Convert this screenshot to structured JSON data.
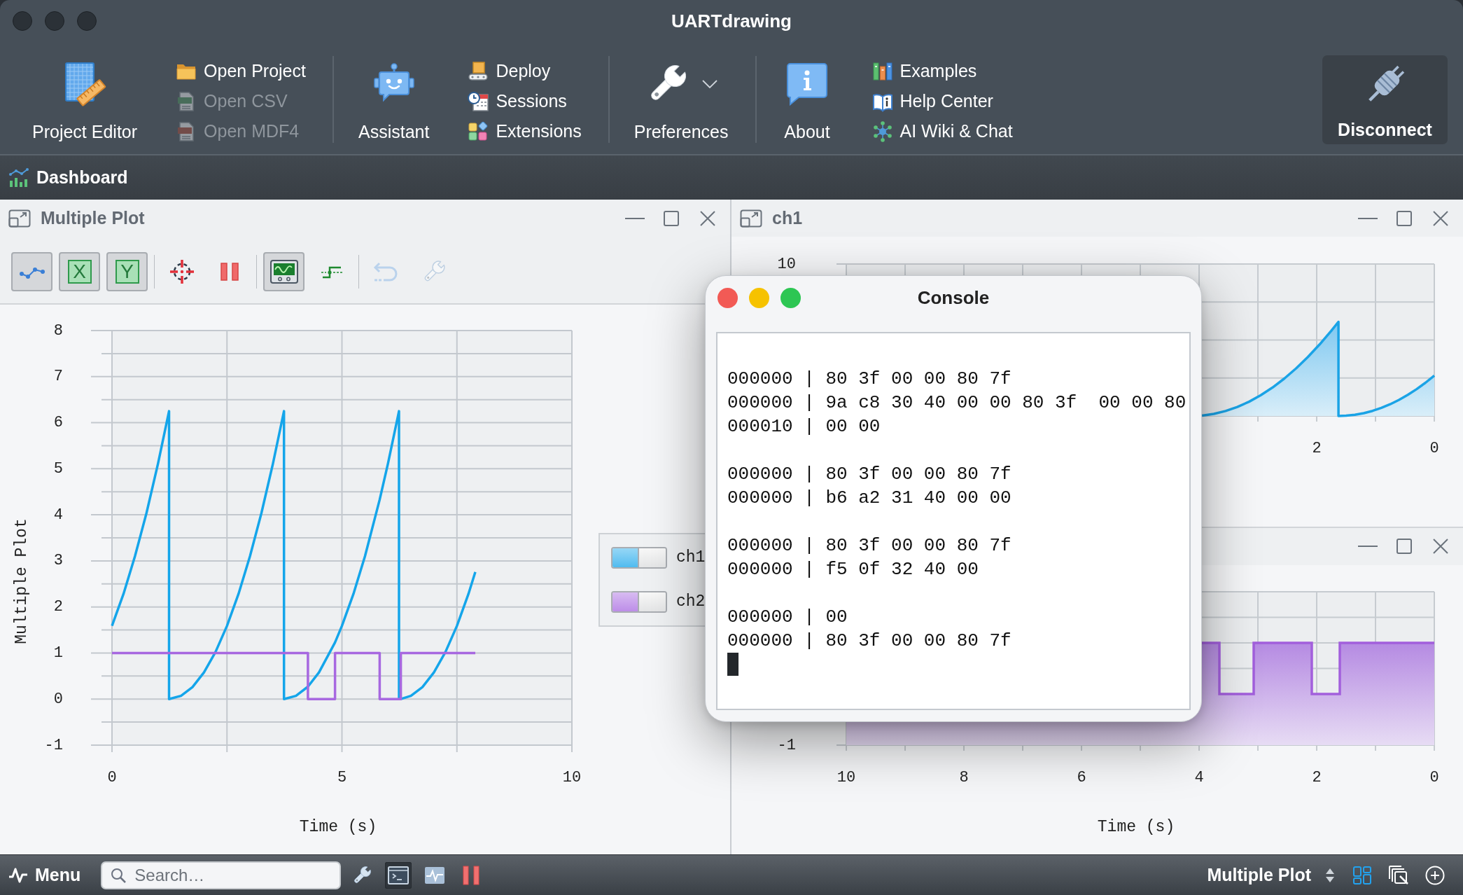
{
  "window": {
    "title": "UARTdrawing"
  },
  "toolbar": {
    "groups": [
      {
        "large": {
          "kind": "button",
          "label": "Project Editor"
        },
        "items": [
          {
            "label": "Open Project",
            "disabled": false
          },
          {
            "label": "Open CSV",
            "disabled": true
          },
          {
            "label": "Open MDF4",
            "disabled": true
          }
        ]
      },
      {
        "large": {
          "kind": "button",
          "label": "Assistant"
        },
        "items": [
          {
            "label": "Deploy",
            "disabled": false
          },
          {
            "label": "Sessions",
            "disabled": false
          },
          {
            "label": "Extensions",
            "disabled": false
          }
        ]
      },
      {
        "large": {
          "kind": "dropdown",
          "label": "Preferences"
        }
      },
      {
        "large": {
          "kind": "button",
          "label": "About"
        },
        "items": [
          {
            "label": "Examples",
            "disabled": false
          },
          {
            "label": "Help Center",
            "disabled": false
          },
          {
            "label": "AI Wiki & Chat",
            "disabled": false
          }
        ]
      }
    ],
    "connection_button": {
      "label": "Disconnect"
    }
  },
  "dashboard": {
    "title": "Dashboard"
  },
  "plot_panel": {
    "title": "Multiple Plot",
    "tool_groups": [
      [
        {
          "kind": "icon",
          "checked": true,
          "disabled": false
        },
        {
          "kind": "letter",
          "label": "X",
          "checked": true,
          "disabled": false
        },
        {
          "kind": "letter",
          "label": "Y",
          "checked": true,
          "disabled": false
        }
      ],
      [
        {
          "kind": "icon",
          "checked": false,
          "disabled": false
        },
        {
          "kind": "icon",
          "checked": false,
          "disabled": false
        }
      ],
      [
        {
          "kind": "icon",
          "checked": true,
          "disabled": false
        },
        {
          "kind": "icon",
          "checked": false,
          "disabled": false
        }
      ],
      [
        {
          "kind": "icon",
          "checked": false,
          "disabled": true
        },
        {
          "kind": "icon",
          "checked": false,
          "disabled": true
        }
      ]
    ],
    "chart_data": {
      "type": "line",
      "xlabel": "Time (s)",
      "ylabel": "Multiple Plot",
      "grid": true,
      "x": [
        0,
        0.25,
        0.5,
        0.75,
        1,
        1.24,
        1.24,
        1.5,
        1.75,
        2,
        2.25,
        2.5,
        2.75,
        3,
        3.25,
        3.5,
        3.74,
        3.74,
        4,
        4.26,
        4.26,
        4.5,
        4.85,
        4.85,
        5,
        5.25,
        5.5,
        5.82,
        5.82,
        6,
        6.24,
        6.24,
        6.28,
        6.28,
        6.5,
        6.75,
        7,
        7.25,
        7.5,
        7.75,
        7.9
      ],
      "series": [
        {
          "name": "ch1",
          "color": "#14a5ea",
          "values": [
            1.59,
            2.28,
            3.1,
            4.04,
            5.11,
            6.25,
            0,
            0.07,
            0.26,
            0.58,
            1.02,
            1.59,
            2.28,
            3.1,
            4.04,
            5.11,
            6.25,
            0,
            0.07,
            0.27,
            0.27,
            0.58,
            1.23,
            1.23,
            1.59,
            2.28,
            3.1,
            4.33,
            4.33,
            5.11,
            6.25,
            0,
            0,
            0,
            0.07,
            0.26,
            0.58,
            1.02,
            1.59,
            2.28,
            2.76
          ]
        },
        {
          "name": "ch2",
          "color": "#a768e0",
          "values": [
            1,
            1,
            1,
            1,
            1,
            1,
            1,
            1,
            1,
            1,
            1,
            1,
            1,
            1,
            1,
            1,
            1,
            1,
            1,
            1,
            0,
            0,
            0,
            1,
            1,
            1,
            1,
            1,
            0,
            0,
            0,
            0,
            0,
            1,
            1,
            1,
            1,
            1,
            1,
            1,
            1
          ]
        }
      ],
      "xlim": [
        0,
        10
      ],
      "ylim": [
        -1,
        8
      ],
      "xticks": [
        0,
        5,
        10
      ],
      "yticks": [
        -1,
        0,
        1,
        2,
        3,
        4,
        5,
        6,
        7,
        8
      ]
    },
    "legend": [
      {
        "on": true
      },
      {
        "on": true
      }
    ]
  },
  "trace_panels": [
    {
      "kind": "ramp",
      "title": "ch1",
      "y_tick_labels": [
        "10"
      ],
      "x_tick_labels": [
        "2",
        "0"
      ]
    },
    {
      "kind": "pulse",
      "y_tick_labels": [
        "-1"
      ],
      "x_tick_labels": [
        "10",
        "8",
        "6",
        "4",
        "2",
        "0"
      ],
      "xlabel": "Time (s)"
    }
  ],
  "console": {
    "title": "Console",
    "blocks": [
      [
        "000000 | 80 3f 00 00 80 7f",
        "000000 | 9a c8 30 40 00 00 80 3f  00 00 80",
        "000010 | 00 00"
      ],
      [
        "000000 | 80 3f 00 00 80 7f",
        "000000 | b6 a2 31 40 00 00"
      ],
      [
        "000000 | 80 3f 00 00 80 7f",
        "000000 | f5 0f 32 40 00"
      ],
      [
        "000000 | 00",
        "000000 | 80 3f 00 00 80 7f"
      ]
    ]
  },
  "status_bar": {
    "menu": {
      "label": "Menu"
    },
    "search": {
      "placeholder": "Search…"
    },
    "tools": [
      {
        "active": false
      },
      {
        "active": true
      },
      {
        "active": false
      },
      {
        "active": false
      }
    ],
    "workspace": {
      "label": "Multiple Plot"
    },
    "actions": [
      {
        "active": true
      },
      {
        "active": false
      },
      {
        "active": false
      }
    ]
  }
}
